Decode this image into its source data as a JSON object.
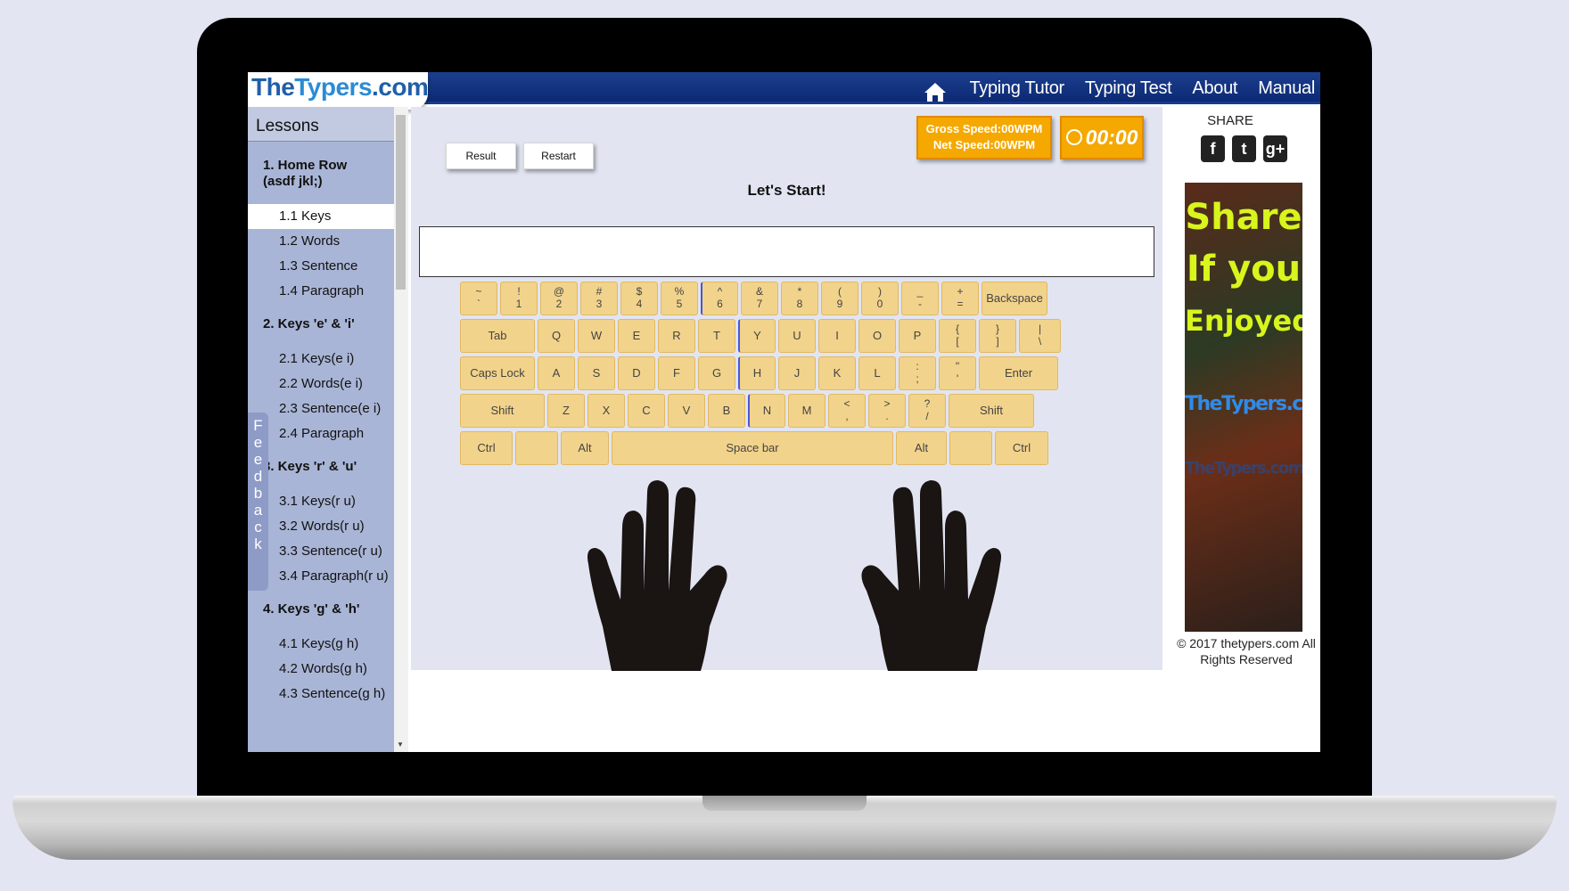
{
  "logo": {
    "part1": "The",
    "part2": "Typers",
    "part3": ".com"
  },
  "nav": {
    "items": [
      "Typing Tutor",
      "Typing Test",
      "About",
      "Manual"
    ]
  },
  "sidebar": {
    "title": "Lessons",
    "groups": [
      {
        "title": "1. Home Row (asdf jkl;)",
        "items": [
          "1.1 Keys",
          "1.2 Words",
          "1.3 Sentence",
          "1.4 Paragraph"
        ]
      },
      {
        "title": "2. Keys 'e' & 'i'",
        "items": [
          "2.1 Keys(e i)",
          "2.2 Words(e i)",
          "2.3 Sentence(e i)",
          "2.4 Paragraph"
        ]
      },
      {
        "title": "3. Keys 'r' & 'u'",
        "items": [
          "3.1 Keys(r u)",
          "3.2 Words(r u)",
          "3.3 Sentence(r u)",
          "3.4 Paragraph(r u)"
        ]
      },
      {
        "title": "4. Keys 'g' & 'h'",
        "items": [
          "4.1 Keys(g h)",
          "4.2 Words(g h)",
          "4.3 Sentence(g h)"
        ]
      }
    ],
    "active_item": "1.1 Keys",
    "feedback": "Feedback"
  },
  "toolbar": {
    "result": "Result",
    "restart": "Restart"
  },
  "stats": {
    "gross": "Gross Speed:00WPM",
    "net": "Net Speed:00WPM",
    "timer": "00:00"
  },
  "heading": "Let's Start!",
  "keyboard": {
    "row1": [
      [
        "~",
        "`"
      ],
      [
        "!",
        "1"
      ],
      [
        "@",
        "2"
      ],
      [
        "#",
        "3"
      ],
      [
        "$",
        "4"
      ],
      [
        "%",
        "5"
      ],
      [
        "^",
        "6"
      ],
      [
        "&",
        "7"
      ],
      [
        "*",
        "8"
      ],
      [
        "(",
        "9"
      ],
      [
        ")",
        "0"
      ],
      [
        "_",
        "-"
      ],
      [
        "+",
        "="
      ],
      [
        "Backspace"
      ]
    ],
    "row2": [
      "Tab",
      "Q",
      "W",
      "E",
      "R",
      "T",
      "Y",
      "U",
      "I",
      "O",
      "P",
      [
        "{",
        "["
      ],
      [
        "}",
        "]"
      ],
      [
        "|",
        "\\"
      ]
    ],
    "row3": [
      "Caps Lock",
      "A",
      "S",
      "D",
      "F",
      "G",
      "H",
      "J",
      "K",
      "L",
      [
        ":",
        ";"
      ],
      [
        "\"",
        "'"
      ],
      "Enter"
    ],
    "row4": [
      "Shift",
      "Z",
      "X",
      "C",
      "V",
      "B",
      "N",
      "M",
      [
        "<",
        ","
      ],
      [
        ">",
        "."
      ],
      [
        "?",
        "/"
      ],
      "Shift"
    ],
    "row5": [
      "Ctrl",
      "",
      "Alt",
      "Space bar",
      "Alt",
      "",
      "Ctrl"
    ]
  },
  "share": {
    "title": "SHARE",
    "icons": [
      "facebook-icon",
      "twitter-icon",
      "google-plus-icon"
    ]
  },
  "ad": {
    "line1": "Share",
    "line2": "If you",
    "line3": "Enjoyed",
    "brand": "TheTypers.com",
    "brand2": "TheTypers.com"
  },
  "copyright": "© 2017 thetypers.com All Rights Reserved",
  "colors": {
    "nav_bg": "#0b2a74",
    "key_bg": "#f2d38b",
    "badge_bg": "#f5a800",
    "sidebar_bg": "#a9b5d6"
  }
}
